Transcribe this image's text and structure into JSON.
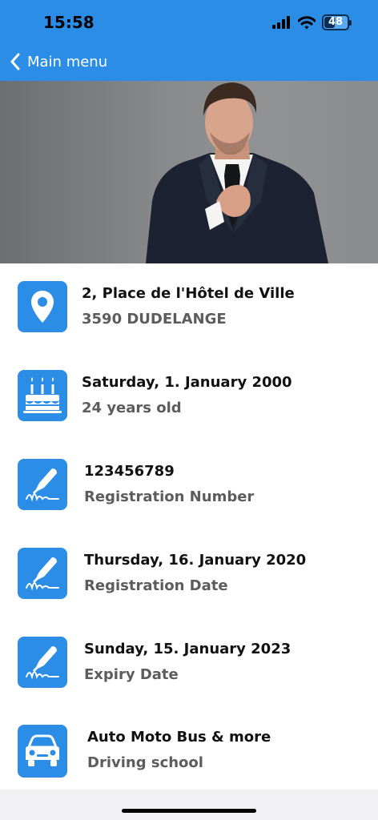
{
  "status": {
    "time": "15:58",
    "battery_level": "48",
    "battery_fraction": 0.48
  },
  "header": {
    "back_label": "Main menu",
    "color": "#2b8de6"
  },
  "hero": {
    "icon": "profile-photo"
  },
  "rows": [
    {
      "icon": "map-pin-icon",
      "title": "2, Place de l'Hôtel de Ville",
      "subtitle": "3590 DUDELANGE"
    },
    {
      "icon": "birthday-cake-icon",
      "title": "Saturday, 1. January 2000",
      "subtitle": "24 years old"
    },
    {
      "icon": "signature-pen-icon",
      "title": "123456789",
      "subtitle": "Registration Number"
    },
    {
      "icon": "signature-pen-icon",
      "title": "Thursday, 16. January 2020",
      "subtitle": "Registration Date"
    },
    {
      "icon": "signature-pen-icon",
      "title": "Sunday, 15. January 2023",
      "subtitle": "Expiry Date"
    },
    {
      "icon": "car-icon",
      "title": "Auto Moto Bus & more",
      "subtitle": "Driving school"
    }
  ]
}
